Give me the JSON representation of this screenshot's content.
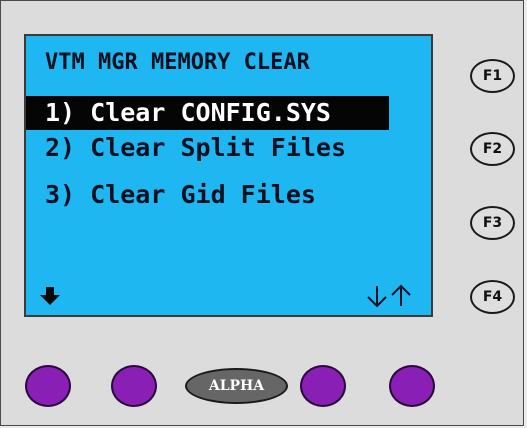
{
  "screen": {
    "title": "VTM MGR MEMORY CLEAR",
    "items": [
      {
        "label": "1) Clear CONFIG.SYS",
        "selected": true
      },
      {
        "label": "2) Clear Split Files",
        "selected": false
      },
      {
        "label": "3) Clear Gid Files",
        "selected": false
      }
    ],
    "icons": {
      "page_down": "down-arrow-icon",
      "scroll": "scroll-down-up-arrows-icon"
    }
  },
  "function_keys": [
    "F1",
    "F2",
    "F3",
    "F4"
  ],
  "soft_keys": {
    "alpha_label": "ALPHA"
  },
  "colors": {
    "screen_background": "#1fb7f2",
    "selection_background": "#050505",
    "softkey": "#8a1fb5",
    "alpha_key": "#666666",
    "device_body": "#dcdcdc"
  }
}
